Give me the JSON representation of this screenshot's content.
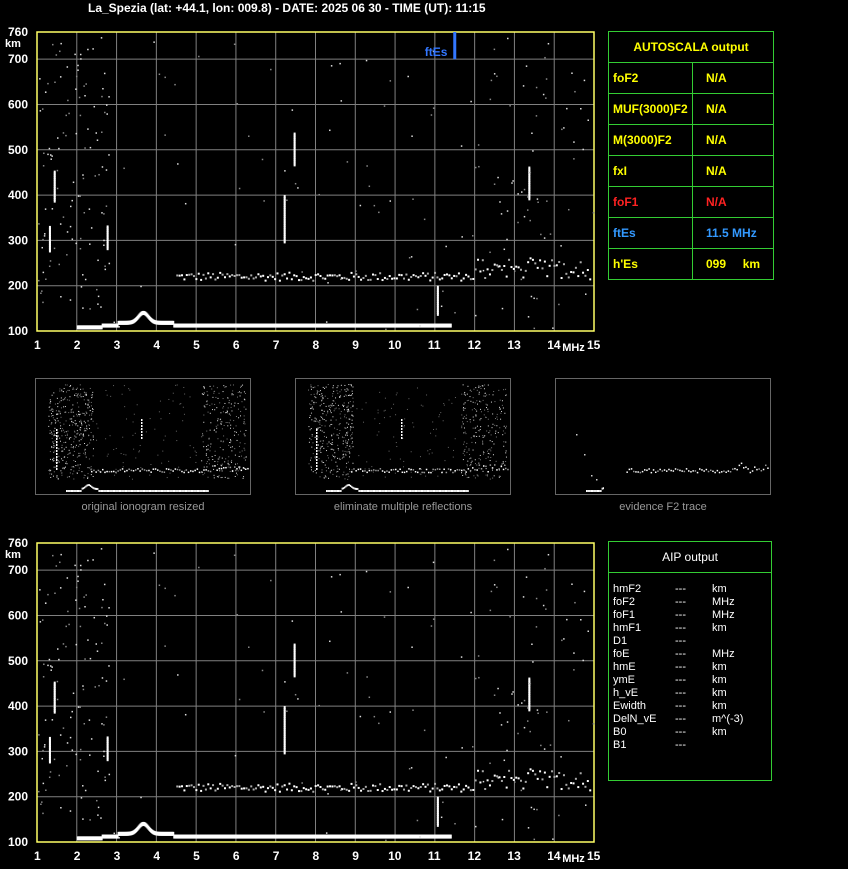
{
  "header": {
    "title": "La_Spezia (lat: +44.1, lon: 009.8) - DATE: 2025 06 30 - TIME (UT): 11:15"
  },
  "colors": {
    "axis": "#ffff66",
    "grid": "#808080",
    "frame": "#33cc33",
    "trace": "#ffffff",
    "fte_marker": "#3377ff",
    "warn": "#ff2222",
    "accent": "#ffff00"
  },
  "chart_data": [
    {
      "type": "scatter",
      "id": "main-ionogram",
      "xlabel": "MHz",
      "ylabel": "km",
      "xlim": [
        1,
        15
      ],
      "ylim": [
        100,
        760
      ],
      "x_ticks": [
        "1",
        "2",
        "3",
        "4",
        "5",
        "6",
        "7",
        "8",
        "9",
        "10",
        "11",
        "12",
        "13",
        "14",
        "15"
      ],
      "y_ticks": [
        "100",
        "200",
        "300",
        "400",
        "500",
        "600",
        "700",
        "760"
      ],
      "marker": {
        "label": "ftEs",
        "x": 11.5,
        "y_from": 700,
        "y_to": 760
      },
      "traces": [
        {
          "name": "",
          "x_from": 2.0,
          "x_to": 11.4,
          "y": 112
        },
        {
          "name": "",
          "x_from": 4.5,
          "x_to": 14.9,
          "y": 225
        }
      ],
      "grid": true
    },
    {
      "type": "scatter",
      "id": "aip-ionogram",
      "xlabel": "MHz",
      "ylabel": "km",
      "xlim": [
        1,
        15
      ],
      "ylim": [
        100,
        760
      ],
      "x_ticks": [
        "1",
        "2",
        "3",
        "4",
        "5",
        "6",
        "7",
        "8",
        "9",
        "10",
        "11",
        "12",
        "13",
        "14",
        "15"
      ],
      "y_ticks": [
        "100",
        "200",
        "300",
        "400",
        "500",
        "600",
        "700",
        "760"
      ],
      "grid": true
    }
  ],
  "autoscala": {
    "title": "AUTOSCALA output",
    "rows": [
      {
        "key": "foF2",
        "value": "N/A",
        "color": "#ffff00"
      },
      {
        "key": "MUF(3000)F2",
        "value": "N/A",
        "color": "#ffff00"
      },
      {
        "key": "M(3000)F2",
        "value": "N/A",
        "color": "#ffff00"
      },
      {
        "key": "fxI",
        "value": "N/A",
        "color": "#ffff00"
      },
      {
        "key": "foF1",
        "value": "N/A",
        "color": "#ff2222"
      },
      {
        "key": "ftEs",
        "value": "11.5 MHz",
        "color": "#3399ff"
      },
      {
        "key": "h'Es",
        "value": "099     km",
        "color": "#ffff00"
      }
    ]
  },
  "thumbs": {
    "original": {
      "caption": "original ionogram resized"
    },
    "eliminate": {
      "caption": "eliminate multiple reflections"
    },
    "evidence": {
      "caption": "evidence F2 trace"
    }
  },
  "aip": {
    "title": "AIP output",
    "rows": [
      {
        "param": "hmF2",
        "value": "---",
        "unit": "km"
      },
      {
        "param": "foF2",
        "value": "---",
        "unit": "MHz"
      },
      {
        "param": "foF1",
        "value": "---",
        "unit": "MHz"
      },
      {
        "param": "hmF1",
        "value": "---",
        "unit": "km"
      },
      {
        "param": "D1",
        "value": "---",
        "unit": ""
      },
      {
        "param": "foE",
        "value": "---",
        "unit": "MHz"
      },
      {
        "param": "hmE",
        "value": "---",
        "unit": "km"
      },
      {
        "param": "ymE",
        "value": "---",
        "unit": "km"
      },
      {
        "param": "h_vE",
        "value": "---",
        "unit": "km"
      },
      {
        "param": "Ewidth",
        "value": "---",
        "unit": "km"
      },
      {
        "param": "DelN_vE",
        "value": "---",
        "unit": "m^(-3)"
      },
      {
        "param": "B0",
        "value": "---",
        "unit": "km"
      },
      {
        "param": "B1",
        "value": "---",
        "unit": ""
      }
    ]
  }
}
